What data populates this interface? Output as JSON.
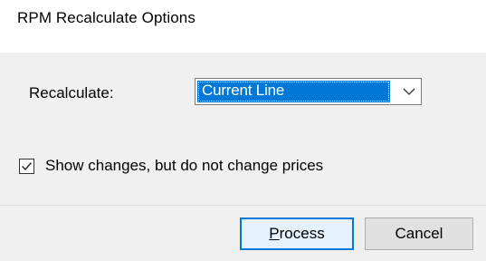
{
  "window": {
    "title": "RPM Recalculate Options"
  },
  "recalculate": {
    "label": "Recalculate:",
    "selected_value": "Current Line",
    "dropdown_icon": "chevron-down-icon"
  },
  "show_changes": {
    "checked": true,
    "label": "Show changes, but do not change prices"
  },
  "buttons": {
    "process_access_key": "P",
    "process_rest": "rocess",
    "cancel_label": "Cancel"
  },
  "colors": {
    "selection": "#0078d7",
    "panel": "#f0f0f0",
    "default_button_border": "#0078d7"
  }
}
